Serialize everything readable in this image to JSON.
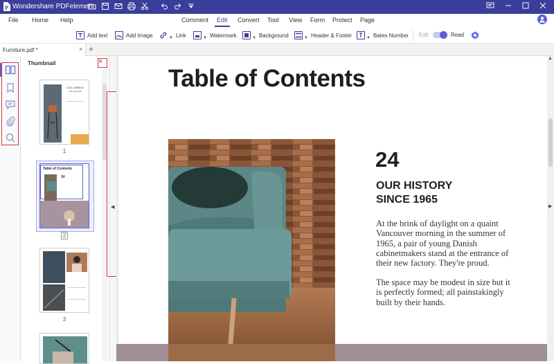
{
  "app": {
    "title": "Wondershare PDFelement"
  },
  "menu": [
    "File",
    "Home",
    "Help",
    "Comment",
    "Edit",
    "Convert",
    "Tool",
    "View",
    "Form",
    "Protect",
    "Page"
  ],
  "menu_active": "Edit",
  "toolbar": {
    "add_text": "Add text",
    "add_image": "Add Image",
    "link": "Link",
    "watermark": "Watermark",
    "background": "Background",
    "header_footer": "Header & Footer",
    "bates_number": "Bates Number",
    "edit_label": "Edit",
    "read_label": "Read"
  },
  "tabs": [
    {
      "label": "Furniture.pdf *"
    }
  ],
  "sidebar": {
    "title": "Thumbnail"
  },
  "thumbnails": [
    {
      "page": "1"
    },
    {
      "page": "2"
    },
    {
      "page": "3"
    }
  ],
  "thumb1": {
    "brand": "COLUMBIA",
    "sub": "COLLECTION"
  },
  "thumb2": {
    "title": "Table of Contents",
    "num": "24"
  },
  "document": {
    "heading": "Table of Contents",
    "number": "24",
    "subheading_line1": "OUR HISTORY",
    "subheading_line2": "SINCE 1965",
    "paragraph1": "At the brink of daylight on a quaint Vancouver morning in the summer of 1965, a pair of young Danish cabinetmakers stand at the entrance of their new factory. They're proud.",
    "paragraph2": "The space may be modest in size but it is perfectly formed; all painstakingly built by their hands."
  },
  "colors": {
    "brand": "#3a3d99",
    "highlight": "#d8343b"
  }
}
